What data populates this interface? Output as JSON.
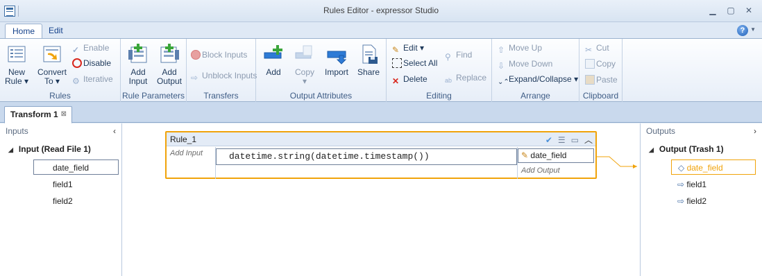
{
  "window": {
    "title": "Rules Editor - expressor Studio",
    "minimize": "▁",
    "maximize": "▢",
    "close": "✕"
  },
  "ribbon_tabs": [
    "Home",
    "Edit"
  ],
  "ribbon": {
    "rules": {
      "label": "Rules",
      "new_rule": "New Rule",
      "convert_to": "Convert To",
      "enable": "Enable",
      "disable": "Disable",
      "iterative": "Iterative"
    },
    "rule_parameters": {
      "label": "Rule Parameters",
      "add_input": "Add Input",
      "add_output": "Add Output"
    },
    "transfers": {
      "label": "Transfers",
      "block_inputs": "Block Inputs",
      "unblock_inputs": "Unblock Inputs"
    },
    "output_attributes": {
      "label": "Output Attributes",
      "add": "Add",
      "copy": "Copy",
      "import": "Import",
      "share": "Share"
    },
    "editing": {
      "label": "Editing",
      "edit": "Edit",
      "select_all": "Select All",
      "delete": "Delete",
      "find": "Find",
      "replace": "Replace"
    },
    "arrange": {
      "label": "Arrange",
      "move_up": "Move Up",
      "move_down": "Move Down",
      "expand_collapse": "Expand/Collapse"
    },
    "clipboard": {
      "label": "Clipboard",
      "cut": "Cut",
      "copy": "Copy",
      "paste": "Paste"
    }
  },
  "document_tab": {
    "label": "Transform 1",
    "close": "⊠"
  },
  "inputs_panel": {
    "title": "Inputs",
    "root": "Input (Read File 1)",
    "fields": [
      "date_field",
      "field1",
      "field2"
    ]
  },
  "outputs_panel": {
    "title": "Outputs",
    "root": "Output (Trash 1)",
    "fields": [
      "date_field",
      "field1",
      "field2"
    ]
  },
  "rule": {
    "title": "Rule_1",
    "add_input": "Add Input",
    "expression": "datetime.string(datetime.timestamp())",
    "output_field": "date_field",
    "add_output": "Add Output"
  },
  "colors": {
    "accent": "#f0a30a",
    "ribbon_text": "#1e395b"
  }
}
